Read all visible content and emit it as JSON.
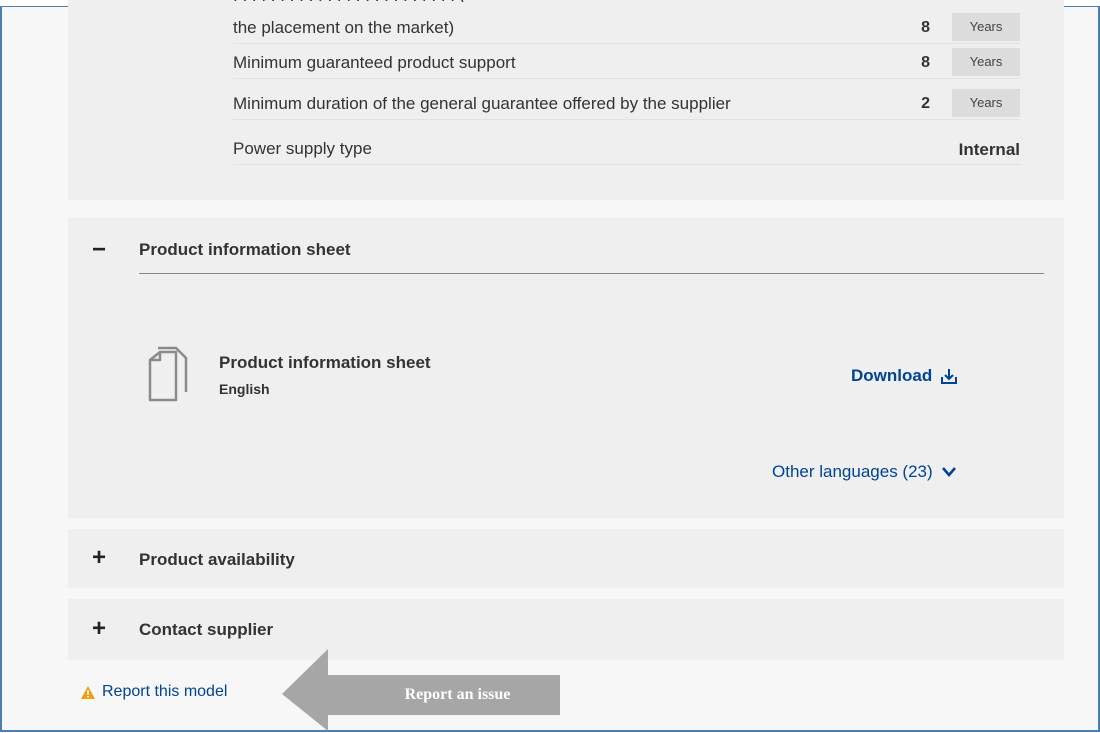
{
  "specs": {
    "rows": [
      {
        "label": "the placement on the market)",
        "value": "8",
        "unit": "Years"
      },
      {
        "label": "Minimum guaranteed product support",
        "value": "8",
        "unit": "Years"
      },
      {
        "label": "Minimum duration of the general guarantee offered by the supplier",
        "value": "2",
        "unit": "Years"
      },
      {
        "label": "Power supply type",
        "value": "Internal"
      }
    ]
  },
  "product_information_sheet": {
    "toggle": "−",
    "title": "Product information sheet",
    "document": {
      "title": "Product information sheet",
      "language": "English",
      "icon": "document-icon"
    },
    "download_label": "Download",
    "other_languages_label": "Other languages (23)"
  },
  "product_availability": {
    "toggle": "+",
    "title": "Product availability"
  },
  "contact_supplier": {
    "toggle": "+",
    "title": "Contact supplier"
  },
  "report": {
    "label": "Report this model",
    "icon": "warning-icon"
  },
  "annotation": {
    "label": "Report an issue"
  },
  "colors": {
    "link": "#004494",
    "panel": "#efefef",
    "frame": "#4a7fb5",
    "warning": "#f39c12",
    "callout": "#a6a6a6"
  }
}
